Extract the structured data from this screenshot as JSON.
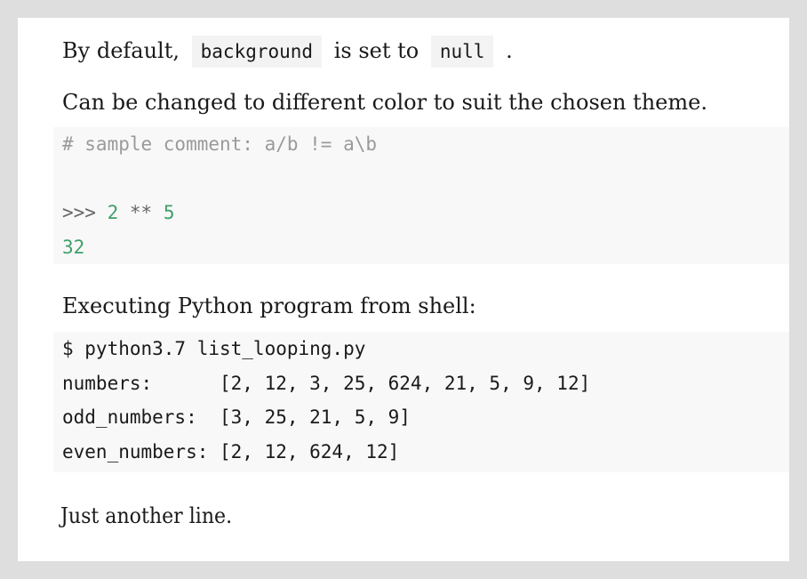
{
  "colors": {
    "page_background": "#dedede",
    "content_background": "#ffffff",
    "code_block_background": "#f8f8f8",
    "inline_code_background": "#f3f3f3",
    "comment": "#9a9a9a",
    "number": "#3f9f6a",
    "prompt": "#666666"
  },
  "paragraph1": {
    "prefix": "By default,",
    "code1": "background",
    "middle": "is set to",
    "code2": "null",
    "suffix": "."
  },
  "paragraph2": "Can be changed to different color to suit the chosen theme.",
  "code_block_1": {
    "comment": "# sample comment: a/b != a\\b",
    "prompt": ">>>",
    "operand1": "2",
    "operator": "**",
    "operand2": "5",
    "result": "32"
  },
  "paragraph3": "Executing Python program from shell:",
  "code_block_2": {
    "lines": [
      "$ python3.7 list_looping.py",
      "numbers:      [2, 12, 3, 25, 624, 21, 5, 9, 12]",
      "odd_numbers:  [3, 25, 21, 5, 9]",
      "even_numbers: [2, 12, 624, 12]"
    ]
  },
  "paragraph4": "Just another line."
}
